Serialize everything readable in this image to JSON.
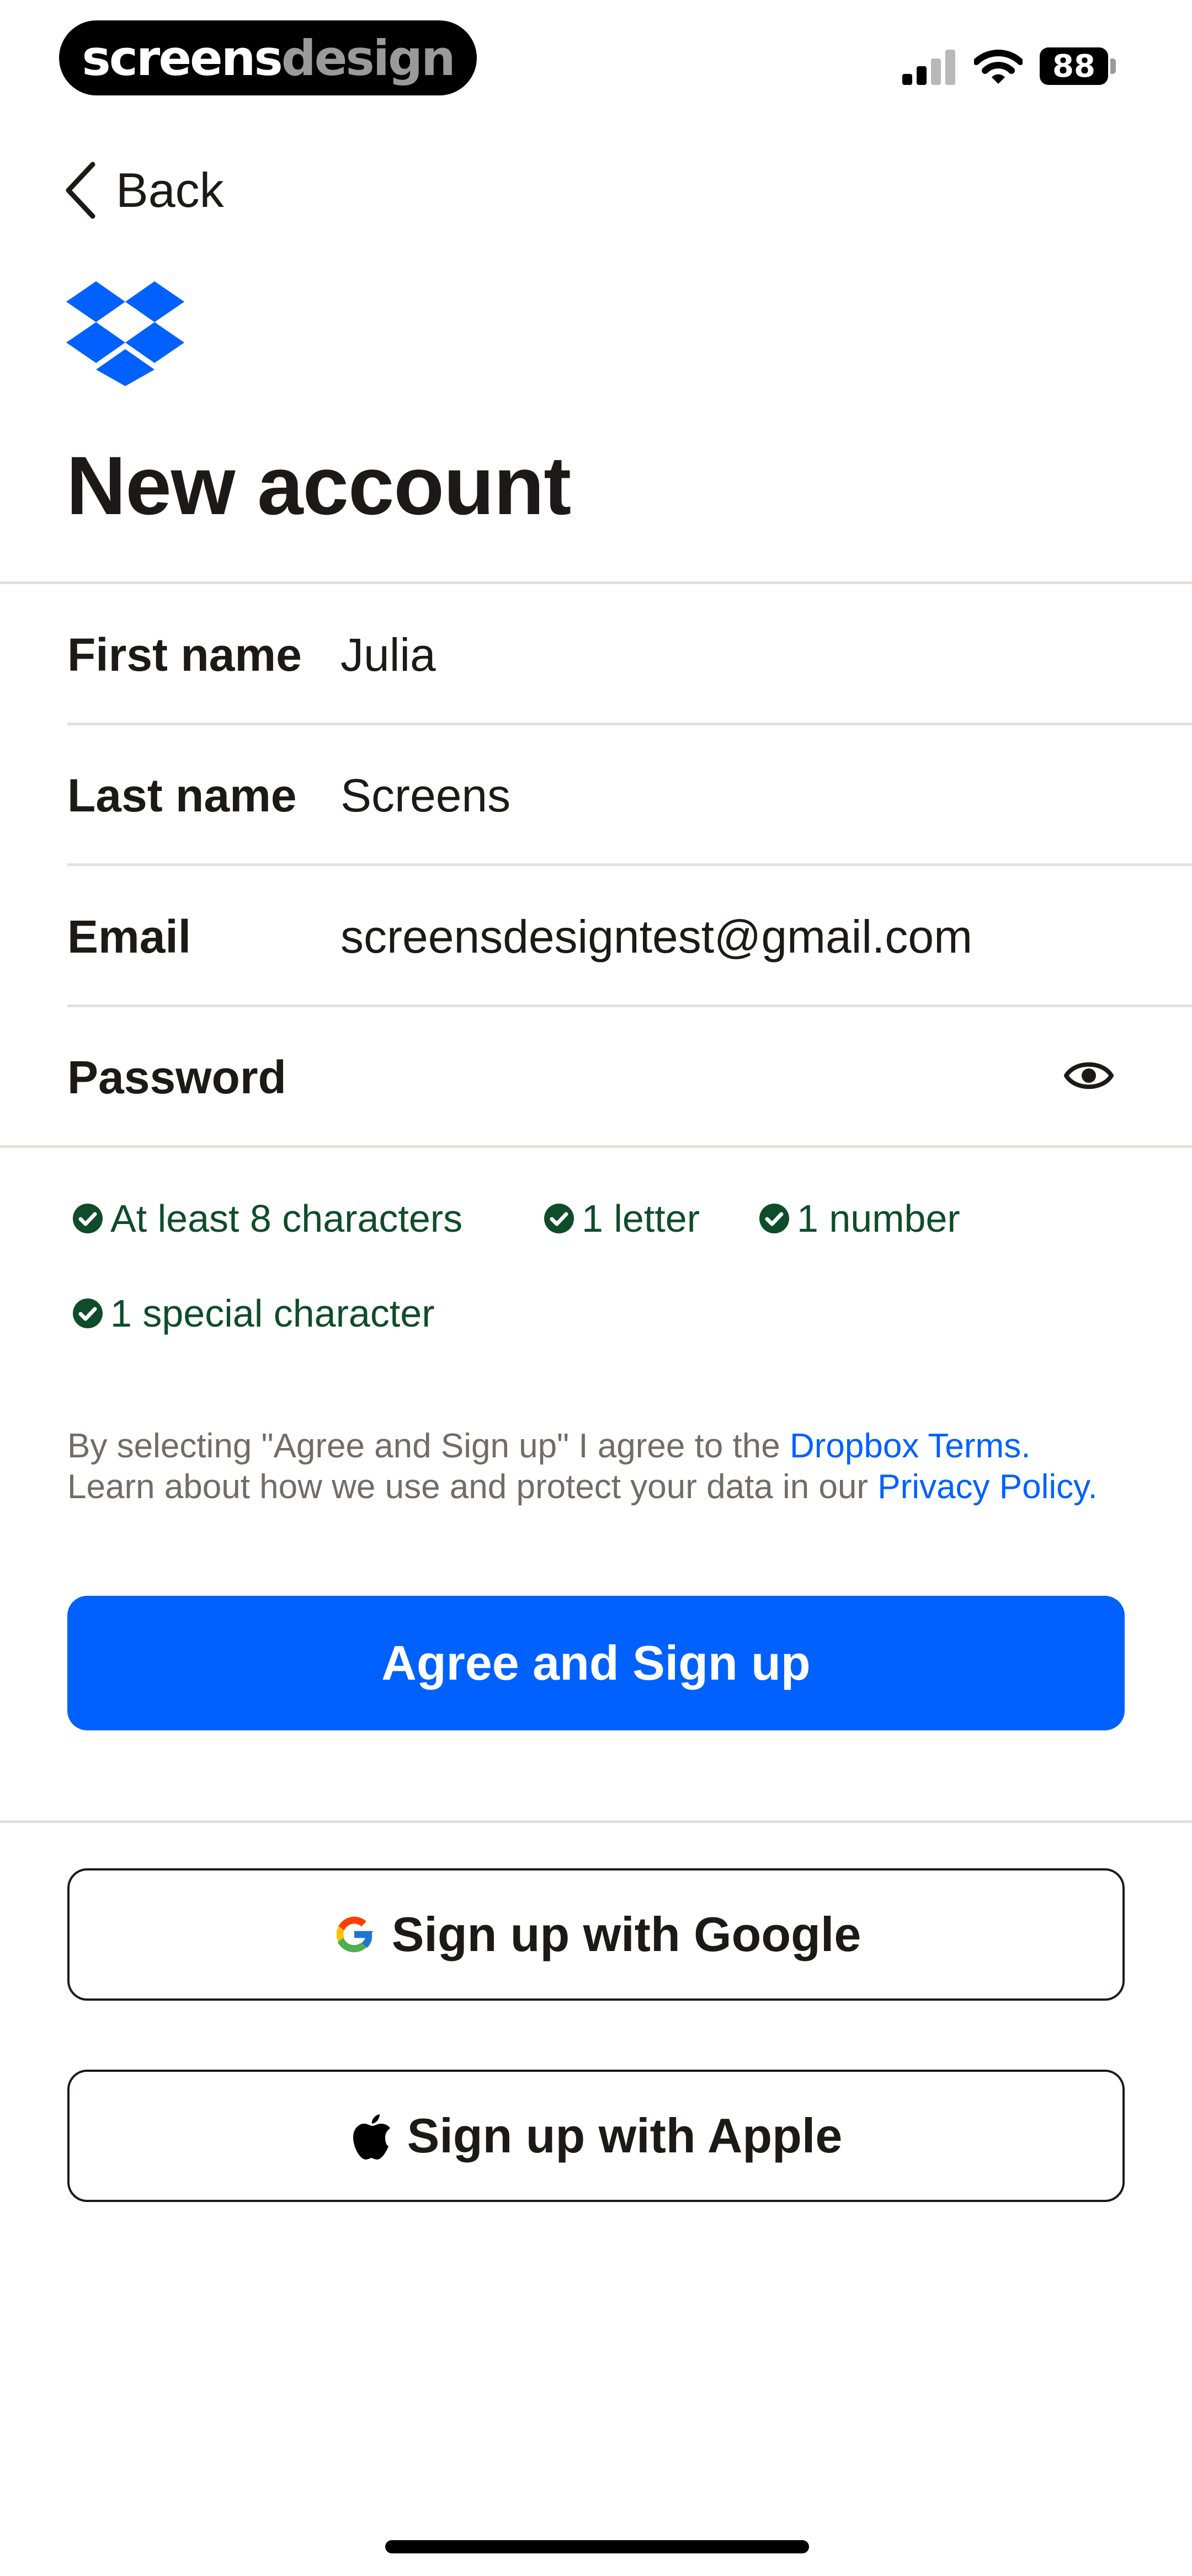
{
  "watermark": {
    "part1": "screens",
    "part2": "design"
  },
  "status_bar": {
    "battery": "88"
  },
  "nav": {
    "back_label": "Back"
  },
  "page": {
    "title": "New account"
  },
  "form": {
    "first_name": {
      "label": "First name",
      "value": "Julia"
    },
    "last_name": {
      "label": "Last name",
      "value": "Screens"
    },
    "email": {
      "label": "Email",
      "value": "screensdesigntest@gmail.com"
    },
    "password": {
      "label": "Password",
      "value": ""
    }
  },
  "requirements": [
    "At least 8 characters",
    "1 letter",
    "1 number",
    "1 special character"
  ],
  "legal": {
    "text1": "By selecting \"Agree and Sign up\" I agree to the ",
    "terms_link": "Dropbox Terms.",
    "text2": " Learn about how we use and protect your data in our ",
    "privacy_link": "Privacy Policy."
  },
  "buttons": {
    "signup": "Agree and Sign up",
    "google": "Sign up with Google",
    "apple": "Sign up with Apple"
  },
  "colors": {
    "primary": "#0061fe",
    "text": "#1e1919",
    "muted": "#736c64",
    "success": "#0f4c2a",
    "divider": "#e3e0dc"
  },
  "icons": [
    "back-chevron-icon",
    "dropbox-logo-icon",
    "eye-icon",
    "check-circle-icon",
    "google-icon",
    "apple-icon",
    "signal-icon",
    "wifi-icon",
    "battery-icon"
  ]
}
